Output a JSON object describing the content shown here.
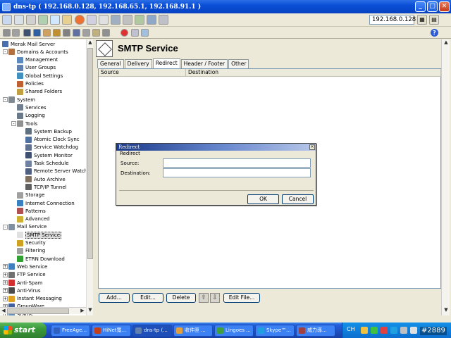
{
  "window": {
    "title": "dns-tp ( 192.168.0.128, 192.168.65.1, 192.168.91.1 )"
  },
  "toolbar": {
    "server_ip": "192.168.0.128"
  },
  "tree": {
    "items": [
      {
        "label": "Merak Mail Server",
        "level": 0,
        "icon": "server-icon",
        "color": "#4a6fb0"
      },
      {
        "label": "Domains & Accounts",
        "level": 1,
        "icon": "users-icon",
        "color": "#b07040",
        "expander": "-"
      },
      {
        "label": "Management",
        "level": 2,
        "icon": "management-icon",
        "color": "#5a8ac0"
      },
      {
        "label": "User Groups",
        "level": 2,
        "icon": "user-groups-icon",
        "color": "#6080b0"
      },
      {
        "label": "Global Settings",
        "level": 2,
        "icon": "globe-settings-icon",
        "color": "#4090c0"
      },
      {
        "label": "Policies",
        "level": 2,
        "icon": "policies-icon",
        "color": "#c06030"
      },
      {
        "label": "Shared Folders",
        "level": 2,
        "icon": "folder-icon",
        "color": "#c0a040"
      },
      {
        "label": "System",
        "level": 1,
        "icon": "system-icon",
        "color": "#808890",
        "expander": "-"
      },
      {
        "label": "Services",
        "level": 2,
        "icon": "services-icon",
        "color": "#708090"
      },
      {
        "label": "Logging",
        "level": 2,
        "icon": "logging-icon",
        "color": "#6a7a8a"
      },
      {
        "label": "Tools",
        "level": 2,
        "icon": "tools-icon",
        "color": "#909090",
        "expander": "-"
      },
      {
        "label": "System Backup",
        "level": 3,
        "icon": "backup-icon",
        "color": "#607080"
      },
      {
        "label": "Atomic Clock Sync",
        "level": 3,
        "icon": "clock-icon",
        "color": "#5070a0"
      },
      {
        "label": "Service Watchdog",
        "level": 3,
        "icon": "watchdog-icon",
        "color": "#607090"
      },
      {
        "label": "System Monitor",
        "level": 3,
        "icon": "monitor-icon",
        "color": "#405070"
      },
      {
        "label": "Task Schedule",
        "level": 3,
        "icon": "schedule-icon",
        "color": "#7080a0"
      },
      {
        "label": "Remote Server Watchdog",
        "level": 3,
        "icon": "remote-watchdog-icon",
        "color": "#506080"
      },
      {
        "label": "Auto Archive",
        "level": 3,
        "icon": "archive-icon",
        "color": "#807060"
      },
      {
        "label": "TCP/IP Tunnel",
        "level": 3,
        "icon": "tunnel-icon",
        "color": "#606060"
      },
      {
        "label": "Storage",
        "level": 2,
        "icon": "storage-icon",
        "color": "#a0a0a0"
      },
      {
        "label": "Internet Connection",
        "level": 2,
        "icon": "internet-icon",
        "color": "#3a80c0"
      },
      {
        "label": "Patterns",
        "level": 2,
        "icon": "patterns-icon",
        "color": "#b05050"
      },
      {
        "label": "Advanced",
        "level": 2,
        "icon": "advanced-icon",
        "color": "#d0b030"
      },
      {
        "label": "Mail Service",
        "level": 1,
        "icon": "mail-service-icon",
        "color": "#8090a0",
        "expander": "-"
      },
      {
        "label": "SMTP Service",
        "level": 2,
        "icon": "smtp-icon",
        "color": "#e0e0e0",
        "selected": true
      },
      {
        "label": "Security",
        "level": 2,
        "icon": "key-icon",
        "color": "#d0a020"
      },
      {
        "label": "Filtering",
        "level": 2,
        "icon": "filter-icon",
        "color": "#a0a0a0"
      },
      {
        "label": "ETRN Download",
        "level": 2,
        "icon": "download-icon",
        "color": "#30a030"
      },
      {
        "label": "Web Service",
        "level": 1,
        "icon": "web-service-icon",
        "color": "#4080c0",
        "expander": "+"
      },
      {
        "label": "FTP Service",
        "level": 1,
        "icon": "ftp-icon",
        "color": "#707070",
        "expander": "+"
      },
      {
        "label": "Anti-Spam",
        "level": 1,
        "icon": "anti-spam-icon",
        "color": "#d03030",
        "expander": "+"
      },
      {
        "label": "Anti-Virus",
        "level": 1,
        "icon": "anti-virus-icon",
        "color": "#4a4a4a",
        "expander": "+"
      },
      {
        "label": "Instant Messaging",
        "level": 1,
        "icon": "messaging-icon",
        "color": "#e0a020",
        "expander": "+"
      },
      {
        "label": "GroupWare",
        "level": 1,
        "icon": "groupware-icon",
        "color": "#4060a0",
        "expander": "+"
      },
      {
        "label": "Status",
        "level": 1,
        "icon": "status-icon",
        "color": "#6090c0",
        "expander": "+"
      }
    ]
  },
  "main": {
    "title": "SMTP Service",
    "tabs": [
      {
        "label": "General"
      },
      {
        "label": "Delivery"
      },
      {
        "label": "Redirect",
        "active": true
      },
      {
        "label": "Header / Footer"
      },
      {
        "label": "Other"
      }
    ],
    "columns": [
      "Source",
      "Destination"
    ],
    "buttons": {
      "add": "Add...",
      "edit": "Edit...",
      "delete": "Delete",
      "edit_file": "Edit File..."
    }
  },
  "dialog": {
    "title": "Redirect",
    "group_label": "Redirect",
    "source_label": "Source:",
    "source_value": "",
    "destination_label": "Destination:",
    "destination_value": "",
    "ok": "OK",
    "cancel": "Cancel"
  },
  "taskbar": {
    "start": "start",
    "tasks": [
      {
        "label": "FreeAge...",
        "color": "#3060c0"
      },
      {
        "label": "HiNet寬...",
        "color": "#c04020"
      },
      {
        "label": "dns-tp (...",
        "color": "#6080b0",
        "active": true
      },
      {
        "label": "收件匣 ...",
        "color": "#e0a040"
      },
      {
        "label": "Lingoes ...",
        "color": "#40a040"
      },
      {
        "label": "Skype™...",
        "color": "#20a0e0"
      },
      {
        "label": "威力導...",
        "color": "#a04040"
      }
    ],
    "lang": "CH",
    "badge": "#2889"
  }
}
